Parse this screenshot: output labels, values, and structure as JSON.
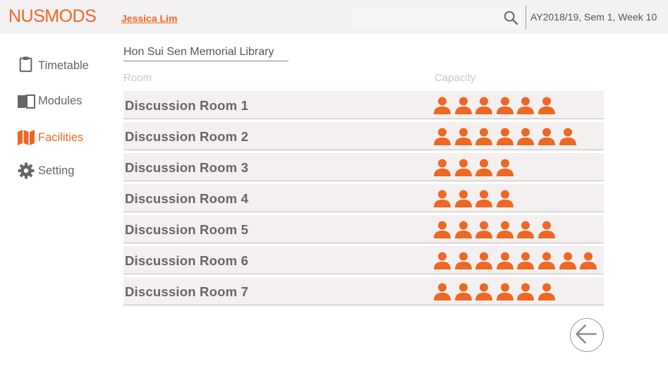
{
  "header": {
    "brand": "NUSMODS",
    "user": "Jessica Lim",
    "term": "AY2018/19, Sem 1, Week 10",
    "search_placeholder": ""
  },
  "sidebar": {
    "items": [
      {
        "label": "Timetable",
        "icon": "clipboard-icon",
        "active": false
      },
      {
        "label": "Modules",
        "icon": "book-icon",
        "active": false
      },
      {
        "label": "Facilities",
        "icon": "map-icon",
        "active": true
      },
      {
        "label": "Setting",
        "icon": "gear-icon",
        "active": false
      }
    ]
  },
  "main": {
    "library": "Hon Sui Sen Memorial Library",
    "columns": {
      "room": "Room",
      "capacity": "Capacity"
    },
    "rooms": [
      {
        "name": "Discussion Room 1",
        "capacity": 6
      },
      {
        "name": "Discussion Room 2",
        "capacity": 7
      },
      {
        "name": "Discussion Room 3",
        "capacity": 4
      },
      {
        "name": "Discussion Room 4",
        "capacity": 4
      },
      {
        "name": "Discussion Room 5",
        "capacity": 6
      },
      {
        "name": "Discussion Room 6",
        "capacity": 8
      },
      {
        "name": "Discussion Room 7",
        "capacity": 6
      }
    ]
  },
  "colors": {
    "accent": "#ee6723",
    "row_bg": "#f5f0f0",
    "text": "#666666"
  },
  "icons": {
    "back": "arrow-left-icon",
    "search": "search-icon",
    "person": "person-icon"
  }
}
